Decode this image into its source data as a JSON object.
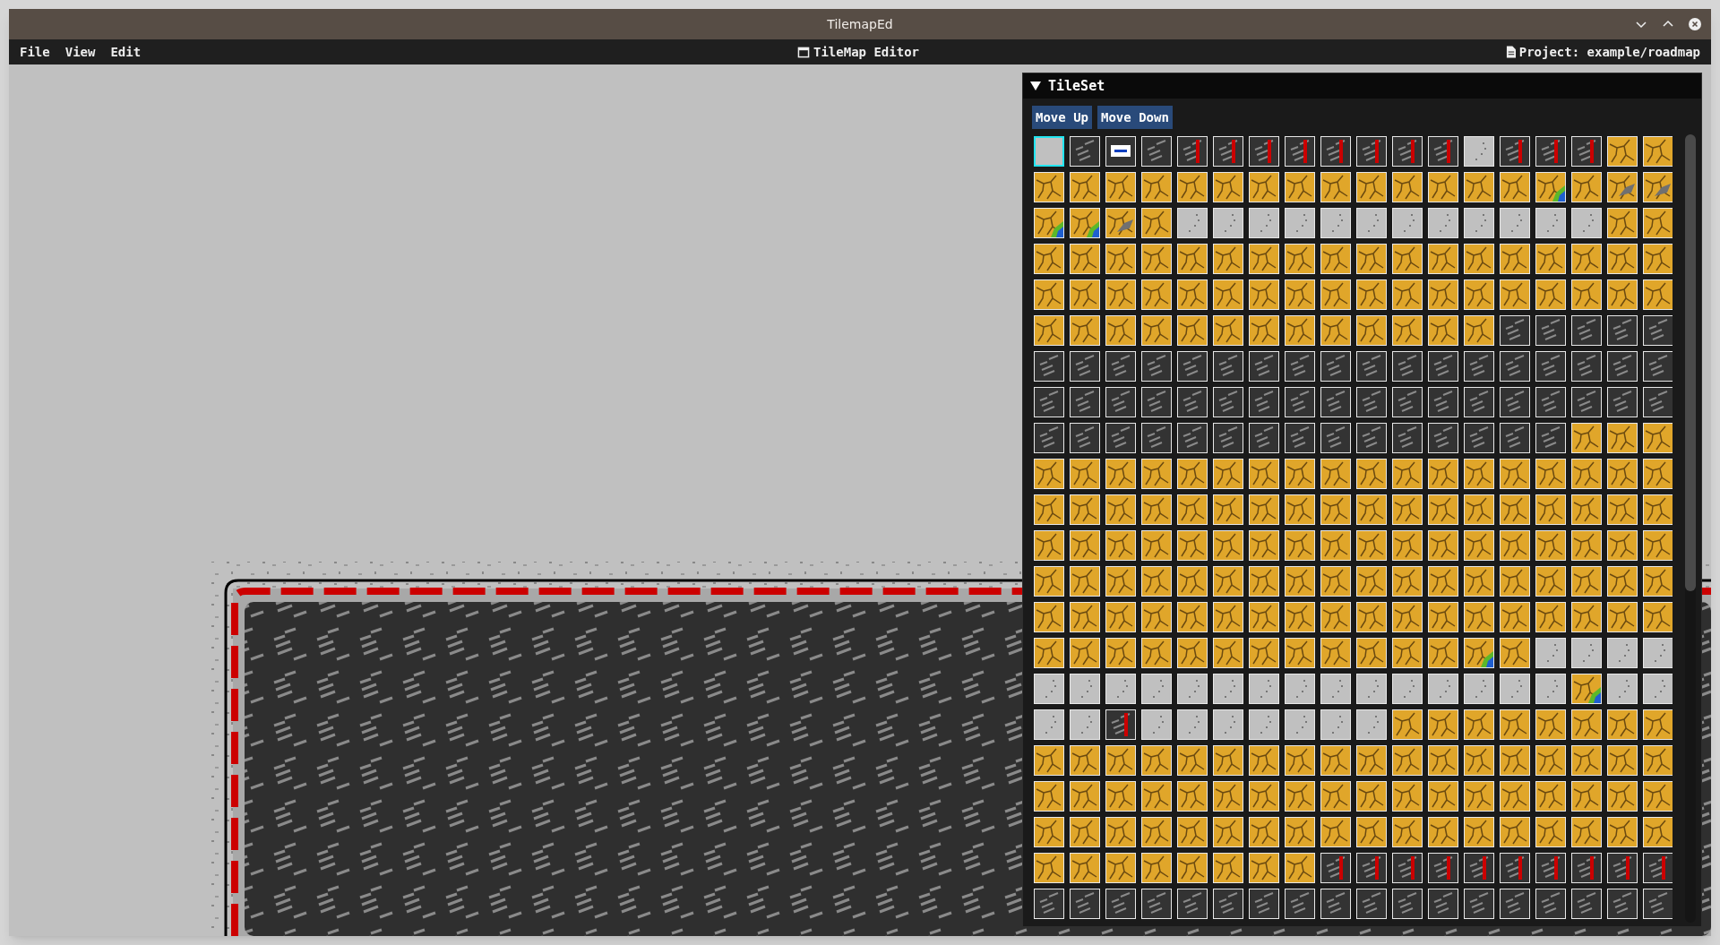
{
  "window": {
    "title": "TilemapEd"
  },
  "menu": [
    {
      "label": "File"
    },
    {
      "label": "View"
    },
    {
      "label": "Edit"
    }
  ],
  "editor_title": "TileMap Editor",
  "project": "Project: example/roadmap",
  "tileset": {
    "title": "TileSet",
    "expanded": true,
    "buttons": [
      "Move Up",
      "Move Down"
    ],
    "rows": [
      [
        {
          "kind": "empty",
          "selected": true
        },
        {
          "kind": "asphalt",
          "selected": false
        },
        {
          "kind": "sign",
          "selected": false
        },
        {
          "kind": "asphalt",
          "selected": false
        },
        {
          "kind": "curb",
          "selected": false
        },
        {
          "kind": "curb",
          "selected": false
        },
        {
          "kind": "curb",
          "selected": false
        },
        {
          "kind": "curb",
          "selected": false
        },
        {
          "kind": "curb",
          "selected": false
        },
        {
          "kind": "curb",
          "selected": false
        },
        {
          "kind": "curb",
          "selected": false
        },
        {
          "kind": "curb",
          "selected": false
        },
        {
          "kind": "concrete",
          "selected": false
        },
        {
          "kind": "curb",
          "selected": false
        },
        {
          "kind": "curb",
          "selected": false
        },
        {
          "kind": "curb",
          "selected": false
        },
        {
          "kind": "sand",
          "selected": false
        },
        {
          "kind": "sand",
          "selected": false
        }
      ],
      [
        {
          "kind": "sand",
          "selected": false
        },
        {
          "kind": "sand",
          "selected": false
        },
        {
          "kind": "sand",
          "selected": false
        },
        {
          "kind": "sand",
          "selected": false
        },
        {
          "kind": "sand",
          "selected": false
        },
        {
          "kind": "sand",
          "selected": false
        },
        {
          "kind": "sand",
          "selected": false
        },
        {
          "kind": "sand",
          "selected": false
        },
        {
          "kind": "sand",
          "selected": false
        },
        {
          "kind": "sand",
          "selected": false
        },
        {
          "kind": "sand",
          "selected": false
        },
        {
          "kind": "sand",
          "selected": false
        },
        {
          "kind": "sand",
          "selected": false
        },
        {
          "kind": "sand",
          "selected": false
        },
        {
          "kind": "pond",
          "selected": false
        },
        {
          "kind": "sand",
          "selected": false
        },
        {
          "kind": "rock",
          "selected": false
        },
        {
          "kind": "rock",
          "selected": false
        }
      ],
      [
        {
          "kind": "pond",
          "selected": false
        },
        {
          "kind": "pond",
          "selected": false
        },
        {
          "kind": "rock",
          "selected": false
        },
        {
          "kind": "sand",
          "selected": false
        },
        {
          "kind": "concrete",
          "selected": false
        },
        {
          "kind": "concrete",
          "selected": false
        },
        {
          "kind": "concrete",
          "selected": false
        },
        {
          "kind": "concrete",
          "selected": false
        },
        {
          "kind": "concrete",
          "selected": false
        },
        {
          "kind": "concrete",
          "selected": false
        },
        {
          "kind": "concrete",
          "selected": false
        },
        {
          "kind": "concrete",
          "selected": false
        },
        {
          "kind": "concrete",
          "selected": false
        },
        {
          "kind": "concrete",
          "selected": false
        },
        {
          "kind": "concrete",
          "selected": false
        },
        {
          "kind": "concrete",
          "selected": false
        },
        {
          "kind": "sand",
          "selected": false
        },
        {
          "kind": "sand",
          "selected": false
        }
      ],
      [
        {
          "kind": "sand",
          "selected": false
        },
        {
          "kind": "sand",
          "selected": false
        },
        {
          "kind": "sand",
          "selected": false
        },
        {
          "kind": "sand",
          "selected": false
        },
        {
          "kind": "sand",
          "selected": false
        },
        {
          "kind": "sand",
          "selected": false
        },
        {
          "kind": "sand",
          "selected": false
        },
        {
          "kind": "sand",
          "selected": false
        },
        {
          "kind": "sand",
          "selected": false
        },
        {
          "kind": "sand",
          "selected": false
        },
        {
          "kind": "sand",
          "selected": false
        },
        {
          "kind": "sand",
          "selected": false
        },
        {
          "kind": "sand",
          "selected": false
        },
        {
          "kind": "sand",
          "selected": false
        },
        {
          "kind": "sand",
          "selected": false
        },
        {
          "kind": "sand",
          "selected": false
        },
        {
          "kind": "sand",
          "selected": false
        },
        {
          "kind": "sand",
          "selected": false
        }
      ],
      [
        {
          "kind": "sand",
          "selected": false
        },
        {
          "kind": "sand",
          "selected": false
        },
        {
          "kind": "sand",
          "selected": false
        },
        {
          "kind": "sand",
          "selected": false
        },
        {
          "kind": "sand",
          "selected": false
        },
        {
          "kind": "sand",
          "selected": false
        },
        {
          "kind": "sand",
          "selected": false
        },
        {
          "kind": "sand",
          "selected": false
        },
        {
          "kind": "sand",
          "selected": false
        },
        {
          "kind": "sand",
          "selected": false
        },
        {
          "kind": "sand",
          "selected": false
        },
        {
          "kind": "sand",
          "selected": false
        },
        {
          "kind": "sand",
          "selected": false
        },
        {
          "kind": "sand",
          "selected": false
        },
        {
          "kind": "sand",
          "selected": false
        },
        {
          "kind": "sand",
          "selected": false
        },
        {
          "kind": "sand",
          "selected": false
        },
        {
          "kind": "sand",
          "selected": false
        }
      ],
      [
        {
          "kind": "sand",
          "selected": false
        },
        {
          "kind": "sand",
          "selected": false
        },
        {
          "kind": "sand",
          "selected": false
        },
        {
          "kind": "sand",
          "selected": false
        },
        {
          "kind": "sand",
          "selected": false
        },
        {
          "kind": "sand",
          "selected": false
        },
        {
          "kind": "sand",
          "selected": false
        },
        {
          "kind": "sand",
          "selected": false
        },
        {
          "kind": "sand",
          "selected": false
        },
        {
          "kind": "sand",
          "selected": false
        },
        {
          "kind": "sand",
          "selected": false
        },
        {
          "kind": "sand",
          "selected": false
        },
        {
          "kind": "sand",
          "selected": false
        },
        {
          "kind": "asphalt",
          "selected": false
        },
        {
          "kind": "asphalt",
          "selected": false
        },
        {
          "kind": "asphalt",
          "selected": false
        },
        {
          "kind": "asphalt",
          "selected": false
        },
        {
          "kind": "asphalt",
          "selected": false
        }
      ],
      [
        {
          "kind": "asphalt",
          "selected": false
        },
        {
          "kind": "asphalt",
          "selected": false
        },
        {
          "kind": "asphalt",
          "selected": false
        },
        {
          "kind": "asphalt",
          "selected": false
        },
        {
          "kind": "asphalt",
          "selected": false
        },
        {
          "kind": "asphalt",
          "selected": false
        },
        {
          "kind": "asphalt",
          "selected": false
        },
        {
          "kind": "asphalt",
          "selected": false
        },
        {
          "kind": "asphalt",
          "selected": false
        },
        {
          "kind": "asphalt",
          "selected": false
        },
        {
          "kind": "asphalt",
          "selected": false
        },
        {
          "kind": "asphalt",
          "selected": false
        },
        {
          "kind": "asphalt",
          "selected": false
        },
        {
          "kind": "asphalt",
          "selected": false
        },
        {
          "kind": "asphalt",
          "selected": false
        },
        {
          "kind": "asphalt",
          "selected": false
        },
        {
          "kind": "asphalt",
          "selected": false
        },
        {
          "kind": "asphalt",
          "selected": false
        }
      ],
      [
        {
          "kind": "asphalt",
          "selected": false
        },
        {
          "kind": "asphalt",
          "selected": false
        },
        {
          "kind": "asphalt",
          "selected": false
        },
        {
          "kind": "asphalt",
          "selected": false
        },
        {
          "kind": "asphalt",
          "selected": false
        },
        {
          "kind": "asphalt",
          "selected": false
        },
        {
          "kind": "asphalt",
          "selected": false
        },
        {
          "kind": "asphalt",
          "selected": false
        },
        {
          "kind": "asphalt",
          "selected": false
        },
        {
          "kind": "asphalt",
          "selected": false
        },
        {
          "kind": "asphalt",
          "selected": false
        },
        {
          "kind": "asphalt",
          "selected": false
        },
        {
          "kind": "asphalt",
          "selected": false
        },
        {
          "kind": "asphalt",
          "selected": false
        },
        {
          "kind": "asphalt",
          "selected": false
        },
        {
          "kind": "asphalt",
          "selected": false
        },
        {
          "kind": "asphalt",
          "selected": false
        },
        {
          "kind": "asphalt",
          "selected": false
        }
      ],
      [
        {
          "kind": "asphalt",
          "selected": false
        },
        {
          "kind": "asphalt",
          "selected": false
        },
        {
          "kind": "asphalt",
          "selected": false
        },
        {
          "kind": "asphalt",
          "selected": false
        },
        {
          "kind": "asphalt",
          "selected": false
        },
        {
          "kind": "asphalt",
          "selected": false
        },
        {
          "kind": "asphalt",
          "selected": false
        },
        {
          "kind": "asphalt",
          "selected": false
        },
        {
          "kind": "asphalt",
          "selected": false
        },
        {
          "kind": "asphalt",
          "selected": false
        },
        {
          "kind": "asphalt",
          "selected": false
        },
        {
          "kind": "asphalt",
          "selected": false
        },
        {
          "kind": "asphalt",
          "selected": false
        },
        {
          "kind": "asphalt",
          "selected": false
        },
        {
          "kind": "asphalt",
          "selected": false
        },
        {
          "kind": "sand",
          "selected": false
        },
        {
          "kind": "sand",
          "selected": false
        },
        {
          "kind": "sand",
          "selected": false
        }
      ],
      [
        {
          "kind": "sand",
          "selected": false
        },
        {
          "kind": "sand",
          "selected": false
        },
        {
          "kind": "sand",
          "selected": false
        },
        {
          "kind": "sand",
          "selected": false
        },
        {
          "kind": "sand",
          "selected": false
        },
        {
          "kind": "sand",
          "selected": false
        },
        {
          "kind": "sand",
          "selected": false
        },
        {
          "kind": "sand",
          "selected": false
        },
        {
          "kind": "sand",
          "selected": false
        },
        {
          "kind": "sand",
          "selected": false
        },
        {
          "kind": "sand",
          "selected": false
        },
        {
          "kind": "sand",
          "selected": false
        },
        {
          "kind": "sand",
          "selected": false
        },
        {
          "kind": "sand",
          "selected": false
        },
        {
          "kind": "sand",
          "selected": false
        },
        {
          "kind": "sand",
          "selected": false
        },
        {
          "kind": "sand",
          "selected": false
        },
        {
          "kind": "sand",
          "selected": false
        }
      ],
      [
        {
          "kind": "sand",
          "selected": false
        },
        {
          "kind": "sand",
          "selected": false
        },
        {
          "kind": "sand",
          "selected": false
        },
        {
          "kind": "sand",
          "selected": false
        },
        {
          "kind": "sand",
          "selected": false
        },
        {
          "kind": "sand",
          "selected": false
        },
        {
          "kind": "sand",
          "selected": false
        },
        {
          "kind": "sand",
          "selected": false
        },
        {
          "kind": "sand",
          "selected": false
        },
        {
          "kind": "sand",
          "selected": false
        },
        {
          "kind": "sand",
          "selected": false
        },
        {
          "kind": "sand",
          "selected": false
        },
        {
          "kind": "sand",
          "selected": false
        },
        {
          "kind": "sand",
          "selected": false
        },
        {
          "kind": "sand",
          "selected": false
        },
        {
          "kind": "sand",
          "selected": false
        },
        {
          "kind": "sand",
          "selected": false
        },
        {
          "kind": "sand",
          "selected": false
        }
      ],
      [
        {
          "kind": "sand",
          "selected": false
        },
        {
          "kind": "sand",
          "selected": false
        },
        {
          "kind": "sand",
          "selected": false
        },
        {
          "kind": "sand",
          "selected": false
        },
        {
          "kind": "sand",
          "selected": false
        },
        {
          "kind": "sand",
          "selected": false
        },
        {
          "kind": "sand",
          "selected": false
        },
        {
          "kind": "sand",
          "selected": false
        },
        {
          "kind": "sand",
          "selected": false
        },
        {
          "kind": "sand",
          "selected": false
        },
        {
          "kind": "sand",
          "selected": false
        },
        {
          "kind": "sand",
          "selected": false
        },
        {
          "kind": "sand",
          "selected": false
        },
        {
          "kind": "sand",
          "selected": false
        },
        {
          "kind": "sand",
          "selected": false
        },
        {
          "kind": "sand",
          "selected": false
        },
        {
          "kind": "sand",
          "selected": false
        },
        {
          "kind": "sand",
          "selected": false
        }
      ],
      [
        {
          "kind": "sand",
          "selected": false
        },
        {
          "kind": "sand",
          "selected": false
        },
        {
          "kind": "sand",
          "selected": false
        },
        {
          "kind": "sand",
          "selected": false
        },
        {
          "kind": "sand",
          "selected": false
        },
        {
          "kind": "sand",
          "selected": false
        },
        {
          "kind": "sand",
          "selected": false
        },
        {
          "kind": "sand",
          "selected": false
        },
        {
          "kind": "sand",
          "selected": false
        },
        {
          "kind": "sand",
          "selected": false
        },
        {
          "kind": "sand",
          "selected": false
        },
        {
          "kind": "sand",
          "selected": false
        },
        {
          "kind": "sand",
          "selected": false
        },
        {
          "kind": "sand",
          "selected": false
        },
        {
          "kind": "sand",
          "selected": false
        },
        {
          "kind": "sand",
          "selected": false
        },
        {
          "kind": "sand",
          "selected": false
        },
        {
          "kind": "sand",
          "selected": false
        }
      ],
      [
        {
          "kind": "sand",
          "selected": false
        },
        {
          "kind": "sand",
          "selected": false
        },
        {
          "kind": "sand",
          "selected": false
        },
        {
          "kind": "sand",
          "selected": false
        },
        {
          "kind": "sand",
          "selected": false
        },
        {
          "kind": "sand",
          "selected": false
        },
        {
          "kind": "sand",
          "selected": false
        },
        {
          "kind": "sand",
          "selected": false
        },
        {
          "kind": "sand",
          "selected": false
        },
        {
          "kind": "sand",
          "selected": false
        },
        {
          "kind": "sand",
          "selected": false
        },
        {
          "kind": "sand",
          "selected": false
        },
        {
          "kind": "sand",
          "selected": false
        },
        {
          "kind": "sand",
          "selected": false
        },
        {
          "kind": "sand",
          "selected": false
        },
        {
          "kind": "sand",
          "selected": false
        },
        {
          "kind": "sand",
          "selected": false
        },
        {
          "kind": "sand",
          "selected": false
        }
      ],
      [
        {
          "kind": "sand",
          "selected": false
        },
        {
          "kind": "sand",
          "selected": false
        },
        {
          "kind": "sand",
          "selected": false
        },
        {
          "kind": "sand",
          "selected": false
        },
        {
          "kind": "sand",
          "selected": false
        },
        {
          "kind": "sand",
          "selected": false
        },
        {
          "kind": "sand",
          "selected": false
        },
        {
          "kind": "sand",
          "selected": false
        },
        {
          "kind": "sand",
          "selected": false
        },
        {
          "kind": "sand",
          "selected": false
        },
        {
          "kind": "sand",
          "selected": false
        },
        {
          "kind": "sand",
          "selected": false
        },
        {
          "kind": "pond",
          "selected": false
        },
        {
          "kind": "sand",
          "selected": false
        },
        {
          "kind": "concrete",
          "selected": false
        },
        {
          "kind": "concrete",
          "selected": false
        },
        {
          "kind": "concrete",
          "selected": false
        },
        {
          "kind": "concrete",
          "selected": false
        }
      ],
      [
        {
          "kind": "concrete",
          "selected": false
        },
        {
          "kind": "concrete",
          "selected": false
        },
        {
          "kind": "concrete",
          "selected": false
        },
        {
          "kind": "concrete",
          "selected": false
        },
        {
          "kind": "concrete",
          "selected": false
        },
        {
          "kind": "concrete",
          "selected": false
        },
        {
          "kind": "concrete",
          "selected": false
        },
        {
          "kind": "concrete",
          "selected": false
        },
        {
          "kind": "concrete",
          "selected": false
        },
        {
          "kind": "concrete",
          "selected": false
        },
        {
          "kind": "concrete",
          "selected": false
        },
        {
          "kind": "concrete",
          "selected": false
        },
        {
          "kind": "concrete",
          "selected": false
        },
        {
          "kind": "concrete",
          "selected": false
        },
        {
          "kind": "concrete",
          "selected": false
        },
        {
          "kind": "pond",
          "selected": false
        },
        {
          "kind": "concrete",
          "selected": false
        },
        {
          "kind": "concrete",
          "selected": false
        }
      ],
      [
        {
          "kind": "concrete",
          "selected": false
        },
        {
          "kind": "concrete",
          "selected": false
        },
        {
          "kind": "curb",
          "selected": false
        },
        {
          "kind": "concrete",
          "selected": false
        },
        {
          "kind": "concrete",
          "selected": false
        },
        {
          "kind": "concrete",
          "selected": false
        },
        {
          "kind": "concrete",
          "selected": false
        },
        {
          "kind": "concrete",
          "selected": false
        },
        {
          "kind": "concrete",
          "selected": false
        },
        {
          "kind": "concrete",
          "selected": false
        },
        {
          "kind": "sand",
          "selected": false
        },
        {
          "kind": "sand",
          "selected": false
        },
        {
          "kind": "sand",
          "selected": false
        },
        {
          "kind": "sand",
          "selected": false
        },
        {
          "kind": "sand",
          "selected": false
        },
        {
          "kind": "sand",
          "selected": false
        },
        {
          "kind": "sand",
          "selected": false
        },
        {
          "kind": "sand",
          "selected": false
        }
      ],
      [
        {
          "kind": "sand",
          "selected": false
        },
        {
          "kind": "sand",
          "selected": false
        },
        {
          "kind": "sand",
          "selected": false
        },
        {
          "kind": "sand",
          "selected": false
        },
        {
          "kind": "sand",
          "selected": false
        },
        {
          "kind": "sand",
          "selected": false
        },
        {
          "kind": "sand",
          "selected": false
        },
        {
          "kind": "sand",
          "selected": false
        },
        {
          "kind": "sand",
          "selected": false
        },
        {
          "kind": "sand",
          "selected": false
        },
        {
          "kind": "sand",
          "selected": false
        },
        {
          "kind": "sand",
          "selected": false
        },
        {
          "kind": "sand",
          "selected": false
        },
        {
          "kind": "sand",
          "selected": false
        },
        {
          "kind": "sand",
          "selected": false
        },
        {
          "kind": "sand",
          "selected": false
        },
        {
          "kind": "sand",
          "selected": false
        },
        {
          "kind": "sand",
          "selected": false
        }
      ],
      [
        {
          "kind": "sand",
          "selected": false
        },
        {
          "kind": "sand",
          "selected": false
        },
        {
          "kind": "sand",
          "selected": false
        },
        {
          "kind": "sand",
          "selected": false
        },
        {
          "kind": "sand",
          "selected": false
        },
        {
          "kind": "sand",
          "selected": false
        },
        {
          "kind": "sand",
          "selected": false
        },
        {
          "kind": "sand",
          "selected": false
        },
        {
          "kind": "sand",
          "selected": false
        },
        {
          "kind": "sand",
          "selected": false
        },
        {
          "kind": "sand",
          "selected": false
        },
        {
          "kind": "sand",
          "selected": false
        },
        {
          "kind": "sand",
          "selected": false
        },
        {
          "kind": "sand",
          "selected": false
        },
        {
          "kind": "sand",
          "selected": false
        },
        {
          "kind": "sand",
          "selected": false
        },
        {
          "kind": "sand",
          "selected": false
        },
        {
          "kind": "sand",
          "selected": false
        }
      ],
      [
        {
          "kind": "sand",
          "selected": false
        },
        {
          "kind": "sand",
          "selected": false
        },
        {
          "kind": "sand",
          "selected": false
        },
        {
          "kind": "sand",
          "selected": false
        },
        {
          "kind": "sand",
          "selected": false
        },
        {
          "kind": "sand",
          "selected": false
        },
        {
          "kind": "sand",
          "selected": false
        },
        {
          "kind": "sand",
          "selected": false
        },
        {
          "kind": "sand",
          "selected": false
        },
        {
          "kind": "sand",
          "selected": false
        },
        {
          "kind": "sand",
          "selected": false
        },
        {
          "kind": "sand",
          "selected": false
        },
        {
          "kind": "sand",
          "selected": false
        },
        {
          "kind": "sand",
          "selected": false
        },
        {
          "kind": "sand",
          "selected": false
        },
        {
          "kind": "sand",
          "selected": false
        },
        {
          "kind": "sand",
          "selected": false
        },
        {
          "kind": "sand",
          "selected": false
        }
      ],
      [
        {
          "kind": "sand",
          "selected": false
        },
        {
          "kind": "sand",
          "selected": false
        },
        {
          "kind": "sand",
          "selected": false
        },
        {
          "kind": "sand",
          "selected": false
        },
        {
          "kind": "sand",
          "selected": false
        },
        {
          "kind": "sand",
          "selected": false
        },
        {
          "kind": "sand",
          "selected": false
        },
        {
          "kind": "sand",
          "selected": false
        },
        {
          "kind": "curb",
          "selected": false
        },
        {
          "kind": "curb",
          "selected": false
        },
        {
          "kind": "curb",
          "selected": false
        },
        {
          "kind": "curb",
          "selected": false
        },
        {
          "kind": "curb",
          "selected": false
        },
        {
          "kind": "curb",
          "selected": false
        },
        {
          "kind": "curb",
          "selected": false
        },
        {
          "kind": "curb",
          "selected": false
        },
        {
          "kind": "curb",
          "selected": false
        },
        {
          "kind": "curb",
          "selected": false
        }
      ],
      [
        {
          "kind": "asphalt",
          "selected": false
        },
        {
          "kind": "asphalt",
          "selected": false
        },
        {
          "kind": "asphalt",
          "selected": false
        },
        {
          "kind": "asphalt",
          "selected": false
        },
        {
          "kind": "asphalt",
          "selected": false
        },
        {
          "kind": "asphalt",
          "selected": false
        },
        {
          "kind": "asphalt",
          "selected": false
        },
        {
          "kind": "asphalt",
          "selected": false
        },
        {
          "kind": "asphalt",
          "selected": false
        },
        {
          "kind": "asphalt",
          "selected": false
        },
        {
          "kind": "asphalt",
          "selected": false
        },
        {
          "kind": "asphalt",
          "selected": false
        },
        {
          "kind": "asphalt",
          "selected": false
        },
        {
          "kind": "asphalt",
          "selected": false
        },
        {
          "kind": "asphalt",
          "selected": false
        },
        {
          "kind": "asphalt",
          "selected": false
        },
        {
          "kind": "asphalt",
          "selected": false
        },
        {
          "kind": "asphalt",
          "selected": false
        }
      ]
    ]
  }
}
